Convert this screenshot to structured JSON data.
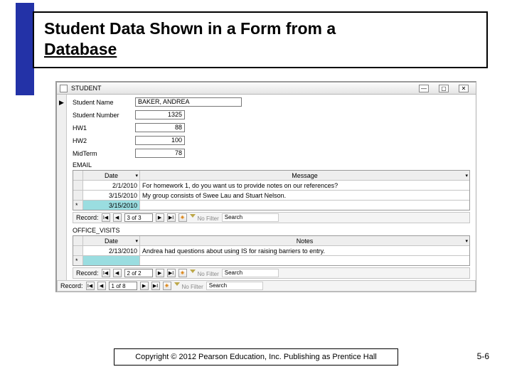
{
  "title": {
    "line1": "Student Data Shown in a Form from a",
    "line2": "Database"
  },
  "window": {
    "title": "STUDENT",
    "btns": {
      "min": "—",
      "max": "▢",
      "close": "✕"
    }
  },
  "fields": {
    "name": {
      "label": "Student Name",
      "value": "BAKER, ANDREA"
    },
    "number": {
      "label": "Student Number",
      "value": "1325"
    },
    "hw1": {
      "label": "HW1",
      "value": "88"
    },
    "hw2": {
      "label": "HW2",
      "value": "100"
    },
    "mid": {
      "label": "MidTerm",
      "value": "78"
    }
  },
  "email": {
    "label": "EMAIL",
    "headers": {
      "date": "Date",
      "msg": "Message"
    },
    "rows": [
      {
        "date": "2/1/2010",
        "msg": "For homework 1, do you want us to provide notes on our references?"
      },
      {
        "date": "3/15/2010",
        "msg": "My group consists of Swee Lau and Stuart Nelson."
      }
    ],
    "newDate": "3/15/2010",
    "nav": {
      "label": "Record:",
      "pos": "3 of 3",
      "filter": "No Filter",
      "search": "Search"
    }
  },
  "office": {
    "label": "OFFICE_VISITS",
    "headers": {
      "date": "Date",
      "notes": "Notes"
    },
    "rows": [
      {
        "date": "2/13/2010",
        "notes": "Andrea had questions about using IS for raising barriers to entry."
      }
    ],
    "nav": {
      "label": "Record:",
      "pos": "2 of 2",
      "filter": "No Filter",
      "search": "Search"
    }
  },
  "outer": {
    "label": "Record:",
    "pos": "1 of 8",
    "filter": "No Filter",
    "search": "Search"
  },
  "navglyph": {
    "first": "I◀",
    "prev": "◀",
    "next": "▶",
    "last": "▶I",
    "new": "✳"
  },
  "copyright": "Copyright © 2012 Pearson Education, Inc. Publishing as Prentice Hall",
  "page": "5-6"
}
